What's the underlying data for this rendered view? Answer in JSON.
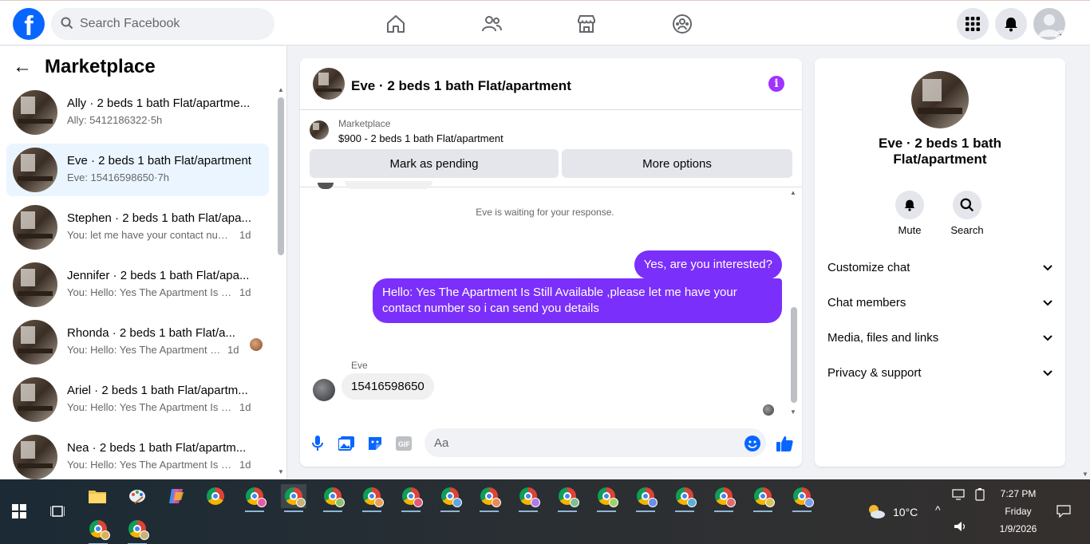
{
  "search": {
    "placeholder": "Search Facebook"
  },
  "sidebar": {
    "title": "Marketplace",
    "conversations": [
      {
        "title": "Ally · 2 beds 1 bath Flat/apartme...",
        "snippet": "Ally: 5412186322",
        "time": "5h"
      },
      {
        "title": "Eve · 2 beds 1 bath Flat/apartment",
        "snippet": "Eve: 15416598650",
        "time": "7h"
      },
      {
        "title": "Stephen · 2 beds 1 bath Flat/apa...",
        "snippet": "You: let me have your contact num...",
        "time": "1d"
      },
      {
        "title": "Jennifer · 2 beds 1 bath Flat/apa...",
        "snippet": "You: Hello: Yes The Apartment Is Sti...",
        "time": "1d"
      },
      {
        "title": "Rhonda · 2 beds 1 bath Flat/a...",
        "snippet": "You: Hello: Yes The Apartment Is ...",
        "time": "1d"
      },
      {
        "title": "Ariel · 2 beds 1 bath Flat/apartm...",
        "snippet": "You: Hello: Yes The Apartment Is Sti...",
        "time": "1d"
      },
      {
        "title": "Nea · 2 beds 1 bath Flat/apartm...",
        "snippet": "You: Hello: Yes The Apartment Is Sti...",
        "time": "1d"
      }
    ]
  },
  "chat": {
    "title": "Eve · 2 beds 1 bath Flat/apartment",
    "listing_source": "Marketplace",
    "listing_title": "$900 - 2 beds 1 bath Flat/apartment",
    "btn_pending": "Mark as pending",
    "btn_more": "More options",
    "waiting_note": "Eve is waiting for your response.",
    "msg_out_1": "Yes, are you interested?",
    "msg_out_2": "Hello: Yes The Apartment Is Still Available ,please let me have your contact number so i can send you details",
    "sender_name": "Eve",
    "msg_in_1": "15416598650",
    "composer_placeholder": "Aa"
  },
  "info": {
    "title": "Eve · 2 beds 1 bath Flat/apartment",
    "mute_label": "Mute",
    "search_label": "Search",
    "rows": [
      "Customize chat",
      "Chat members",
      "Media, files and links",
      "Privacy & support"
    ]
  },
  "taskbar": {
    "weather": "10°C",
    "time": "7:27 PM",
    "day": "Friday",
    "date": "1/9/2026"
  },
  "colors": {
    "facebook_blue": "#0866ff",
    "message_purple": "#7b2ffa",
    "active_conversation_bg": "#ebf5ff"
  }
}
